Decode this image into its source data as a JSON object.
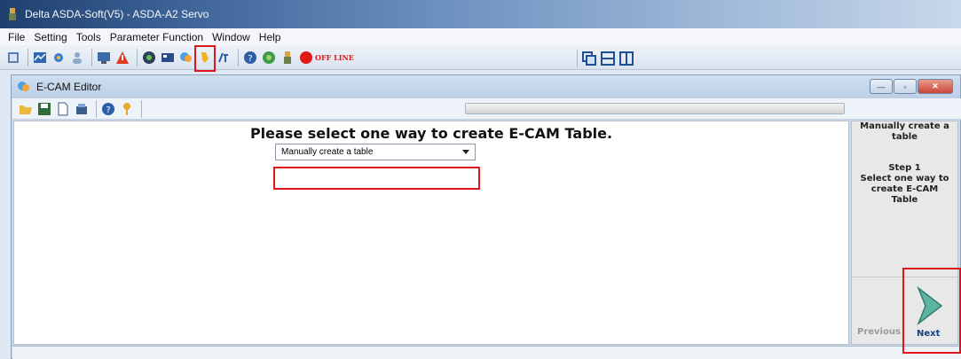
{
  "window": {
    "title": "Delta ASDA-Soft(V5) - ASDA-A2 Servo"
  },
  "menu": [
    "File",
    "Setting",
    "Tools",
    "Parameter Function",
    "Window",
    "Help"
  ],
  "toolbar": {
    "offline_label": "OFF LINE"
  },
  "child": {
    "title": "E-CAM Editor",
    "heading": "Please select one way to create E-CAM Table.",
    "method_select": {
      "value": "Manually create a table"
    },
    "side": {
      "method_title": "Manually create a table",
      "step_title": "Step 1",
      "step_desc": "Select one way to create E-CAM Table"
    },
    "previous_label": "Previous",
    "next_label": "Next"
  },
  "colors": {
    "highlight": "#e0141b",
    "offline": "#e01a1a"
  }
}
